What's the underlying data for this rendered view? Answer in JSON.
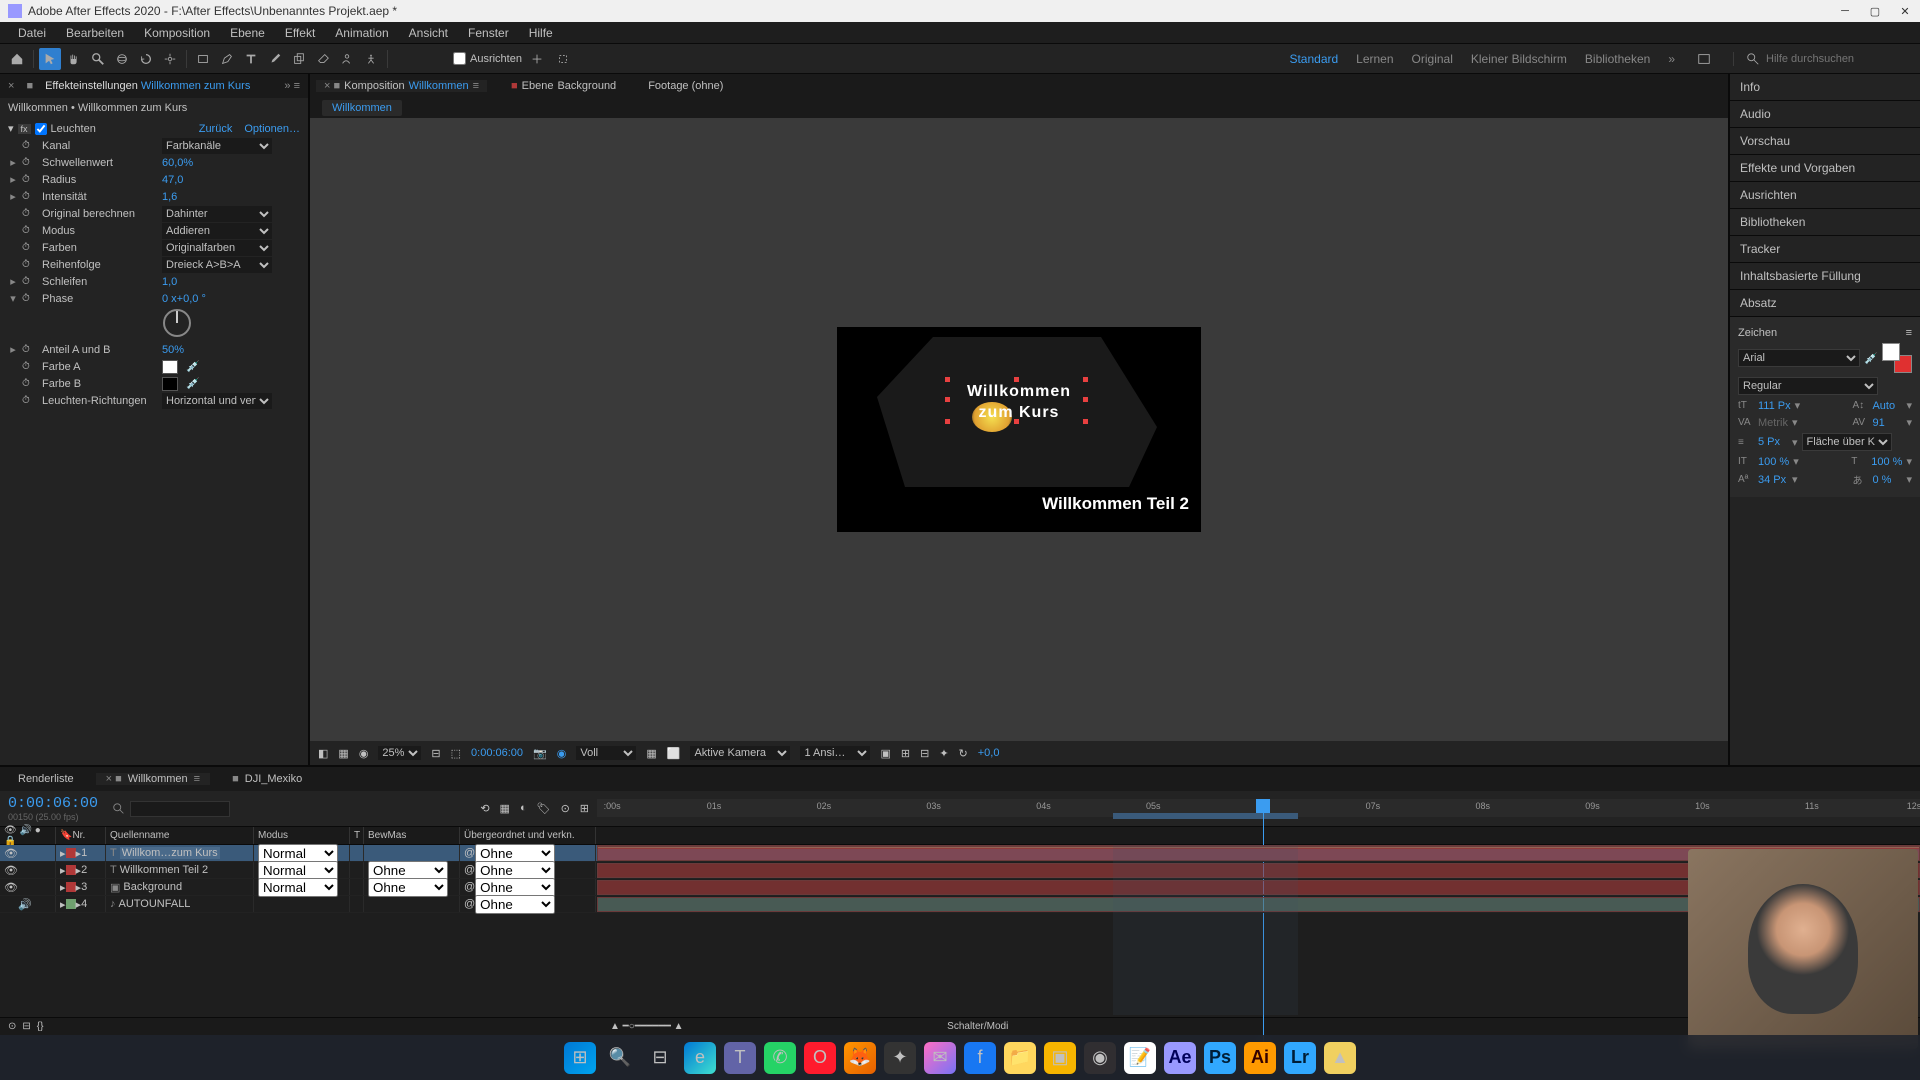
{
  "window": {
    "title": "Adobe After Effects 2020 - F:\\After Effects\\Unbenanntes Projekt.aep *"
  },
  "menu": [
    "Datei",
    "Bearbeiten",
    "Komposition",
    "Ebene",
    "Effekt",
    "Animation",
    "Ansicht",
    "Fenster",
    "Hilfe"
  ],
  "toolbar": {
    "snapping": "Ausrichten",
    "workspaces": [
      "Standard",
      "Lernen",
      "Original",
      "Kleiner Bildschirm",
      "Bibliotheken"
    ],
    "search_ph": "Hilfe durchsuchen"
  },
  "effect_panel": {
    "tab_label": "Effekteinstellungen",
    "tab_comp": "Willkommen zum Kurs",
    "breadcrumb": "Willkommen • Willkommen zum Kurs",
    "fx_name": "Leuchten",
    "reset": "Zurück",
    "options": "Optionen…",
    "props": {
      "kanal": "Kanal",
      "kanal_v": "Farbkanäle",
      "schwelle": "Schwellenwert",
      "schwelle_v": "60,0%",
      "radius": "Radius",
      "radius_v": "47,0",
      "intensitat": "Intensität",
      "intensitat_v": "1,6",
      "original": "Original berechnen",
      "original_v": "Dahinter",
      "modus": "Modus",
      "modus_v": "Addieren",
      "farben": "Farben",
      "farben_v": "Originalfarben",
      "reihen": "Reihenfolge",
      "reihen_v": "Dreieck A>B>A",
      "schleifen": "Schleifen",
      "schleifen_v": "1,0",
      "phase": "Phase",
      "phase_v": "0 x+0,0 °",
      "anteil": "Anteil A und B",
      "anteil_v": "50%",
      "farbeA": "Farbe A",
      "farbeB": "Farbe B",
      "richtungen": "Leuchten-Richtungen",
      "richtungen_v": "Horizontal und vert"
    }
  },
  "comp_panel": {
    "tab1_prefix": "Komposition",
    "tab1_name": "Willkommen",
    "tab2_prefix": "Ebene",
    "tab2_name": "Background",
    "tab3": "Footage (ohne)",
    "crumb": "Willkommen",
    "text1_line1": "Willkommen",
    "text1_line2": "zum Kurs",
    "text2": "Willkommen Teil 2",
    "zoom": "25%",
    "timecode": "0:00:06:00",
    "res": "Voll",
    "camera": "Aktive Kamera",
    "view": "1 Ansi…",
    "expo": "+0,0"
  },
  "right_panel": {
    "sections": [
      "Info",
      "Audio",
      "Vorschau",
      "Effekte und Vorgaben",
      "Ausrichten",
      "Bibliotheken",
      "Tracker",
      "Inhaltsbasierte Füllung",
      "Absatz"
    ],
    "char_title": "Zeichen",
    "font": "Arial",
    "style": "Regular",
    "size": "111 Px",
    "leading": "Auto",
    "kerning": "Metrik",
    "tracking": "91",
    "stroke": "5 Px",
    "stroke_opt": "Fläche über Kon…",
    "vscale": "100 %",
    "hscale": "100 %",
    "baseline": "34 Px",
    "tsume": "0 %"
  },
  "timeline": {
    "tab_render": "Renderliste",
    "tab_comp": "Willkommen",
    "tab_dji": "DJI_Mexiko",
    "timecode": "0:00:06:00",
    "framerate": "00150 (25.00 fps)",
    "cols": {
      "nr": "Nr.",
      "name": "Quellenname",
      "mode": "Modus",
      "t": "T",
      "trk": "BewMas",
      "parent": "Übergeordnet und verkn."
    },
    "layers": [
      {
        "idx": "1",
        "name": "Willkom…zum Kurs",
        "type": "T",
        "mode": "Normal",
        "trk": "",
        "parent": "Ohne",
        "color": "#b03838"
      },
      {
        "idx": "2",
        "name": "Willkommen Teil 2",
        "type": "T",
        "mode": "Normal",
        "trk": "Ohne",
        "parent": "Ohne",
        "color": "#b03838"
      },
      {
        "idx": "3",
        "name": "Background",
        "type": "img",
        "mode": "Normal",
        "trk": "Ohne",
        "parent": "Ohne",
        "color": "#b03838"
      },
      {
        "idx": "4",
        "name": "AUTOUNFALL",
        "type": "audio",
        "mode": "",
        "trk": "",
        "parent": "Ohne",
        "color": "#6fa06f"
      }
    ],
    "ruler": [
      ":00s",
      "01s",
      "02s",
      "03s",
      "04s",
      "05s",
      "06s",
      "07s",
      "08s",
      "09s",
      "10s",
      "11s",
      "12s"
    ],
    "footer": "Schalter/Modi"
  },
  "taskbar_icons": [
    "windows",
    "search",
    "tasks",
    "edge",
    "teams",
    "whatsapp",
    "opera",
    "firefox",
    "app1",
    "messenger",
    "facebook",
    "files",
    "app2",
    "obs",
    "notes",
    "Ae",
    "Ps",
    "Ai",
    "Lr",
    "app3"
  ]
}
